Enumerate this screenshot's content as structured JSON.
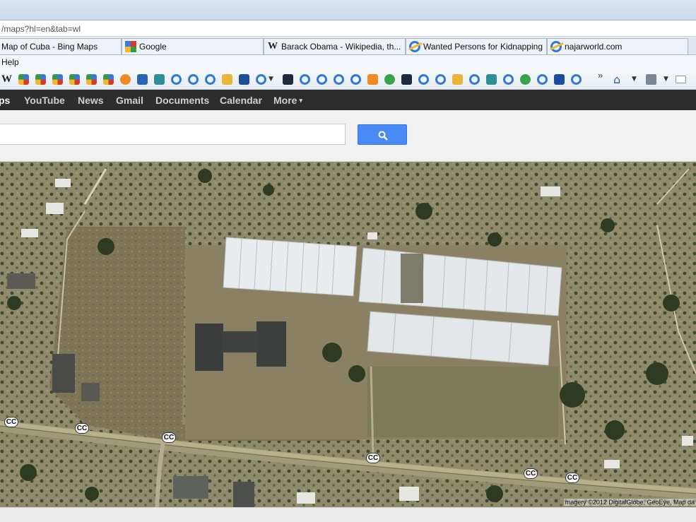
{
  "browser": {
    "address": "/maps?hl=en&tab=wl",
    "tabs": [
      {
        "label": "Map of Cuba - Bing Maps",
        "icon": "bing-tab-icon"
      },
      {
        "label": "Google",
        "icon": "google-tab-icon"
      },
      {
        "label": "Barack Obama - Wikipedia, th...",
        "icon": "wikipedia-tab-icon"
      },
      {
        "label": "Wanted Persons for Kidnapping",
        "icon": "ie-page-icon"
      },
      {
        "label": "najarworld.com",
        "icon": "ie-page-icon"
      }
    ],
    "menu": {
      "help": "Help"
    }
  },
  "google_bar": {
    "items": [
      {
        "label": "ps"
      },
      {
        "label": "YouTube"
      },
      {
        "label": "News"
      },
      {
        "label": "Gmail"
      },
      {
        "label": "Documents"
      },
      {
        "label": "Calendar"
      },
      {
        "label": "More"
      }
    ],
    "more_caret": "▾"
  },
  "search": {
    "value": "",
    "button_icon": "search-icon",
    "button_color": "#4a8af4"
  },
  "map": {
    "view": "satellite",
    "markers": [
      "CC",
      "CC",
      "CC",
      "CC",
      "CC",
      "CC"
    ],
    "attribution": "magery ©2012 DigitalGlobe, GeoEye, Map da"
  },
  "colors": {
    "google_bar_bg": "#2d2d2d",
    "google_bar_active": "#ffffff",
    "google_bar_text": "#cfcfcf"
  }
}
